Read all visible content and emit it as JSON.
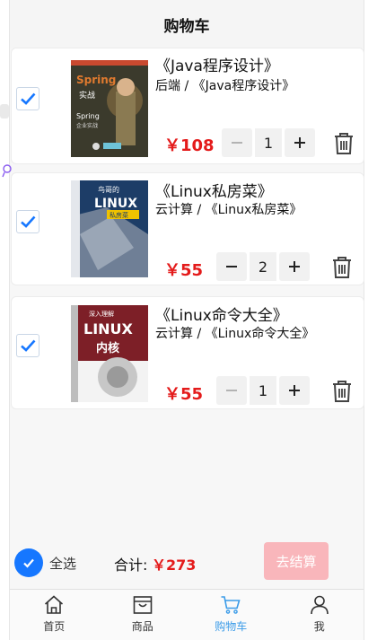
{
  "header": {
    "title": "购物车"
  },
  "items": [
    {
      "title": "《Java程序设计》",
      "category": "后端 / 《Java程序设计》",
      "price": "￥108",
      "qty": "1",
      "checked": true,
      "minus_disabled": true
    },
    {
      "title": "《Linux私房菜》",
      "category": "云计算 / 《Linux私房菜》",
      "price": "￥55",
      "qty": "2",
      "checked": true,
      "minus_disabled": false
    },
    {
      "title": "《Linux命令大全》",
      "category": "云计算 / 《Linux命令大全》",
      "price": "￥55",
      "qty": "1",
      "checked": true,
      "minus_disabled": true
    }
  ],
  "covers": [
    {
      "top_text": "Spring",
      "top_sub": "实战",
      "bottom_text": "Spring",
      "bottom_sub": "企业实战",
      "color": "#3b3a2c",
      "accent": "#e07a2f"
    },
    {
      "top_text": "鸟哥的",
      "top_sub": "LINUX",
      "bottom_text": "私房菜",
      "bottom_sub": "",
      "color": "#1d3d67",
      "accent": "#f0c200"
    },
    {
      "top_text": "深入理解",
      "top_sub": "LINUX",
      "bottom_text": "内核",
      "bottom_sub": "",
      "color": "#7d1f27",
      "accent": "#ffffff"
    }
  ],
  "footer": {
    "select_all_label": "全选",
    "total_label": "合计:",
    "total_value": "￥273",
    "checkout_label": "去结算"
  },
  "tabbar": [
    {
      "label": "首页",
      "icon": "home-icon",
      "active": false
    },
    {
      "label": "商品",
      "icon": "shop-bag-icon",
      "active": false
    },
    {
      "label": "购物车",
      "icon": "cart-icon",
      "active": true
    },
    {
      "label": "我",
      "icon": "user-icon",
      "active": false
    }
  ],
  "colors": {
    "price": "#e41b1b",
    "checkbox": "#1677ff",
    "checkout_bg": "#f9b6bb",
    "active_tab": "#3a9be8"
  }
}
